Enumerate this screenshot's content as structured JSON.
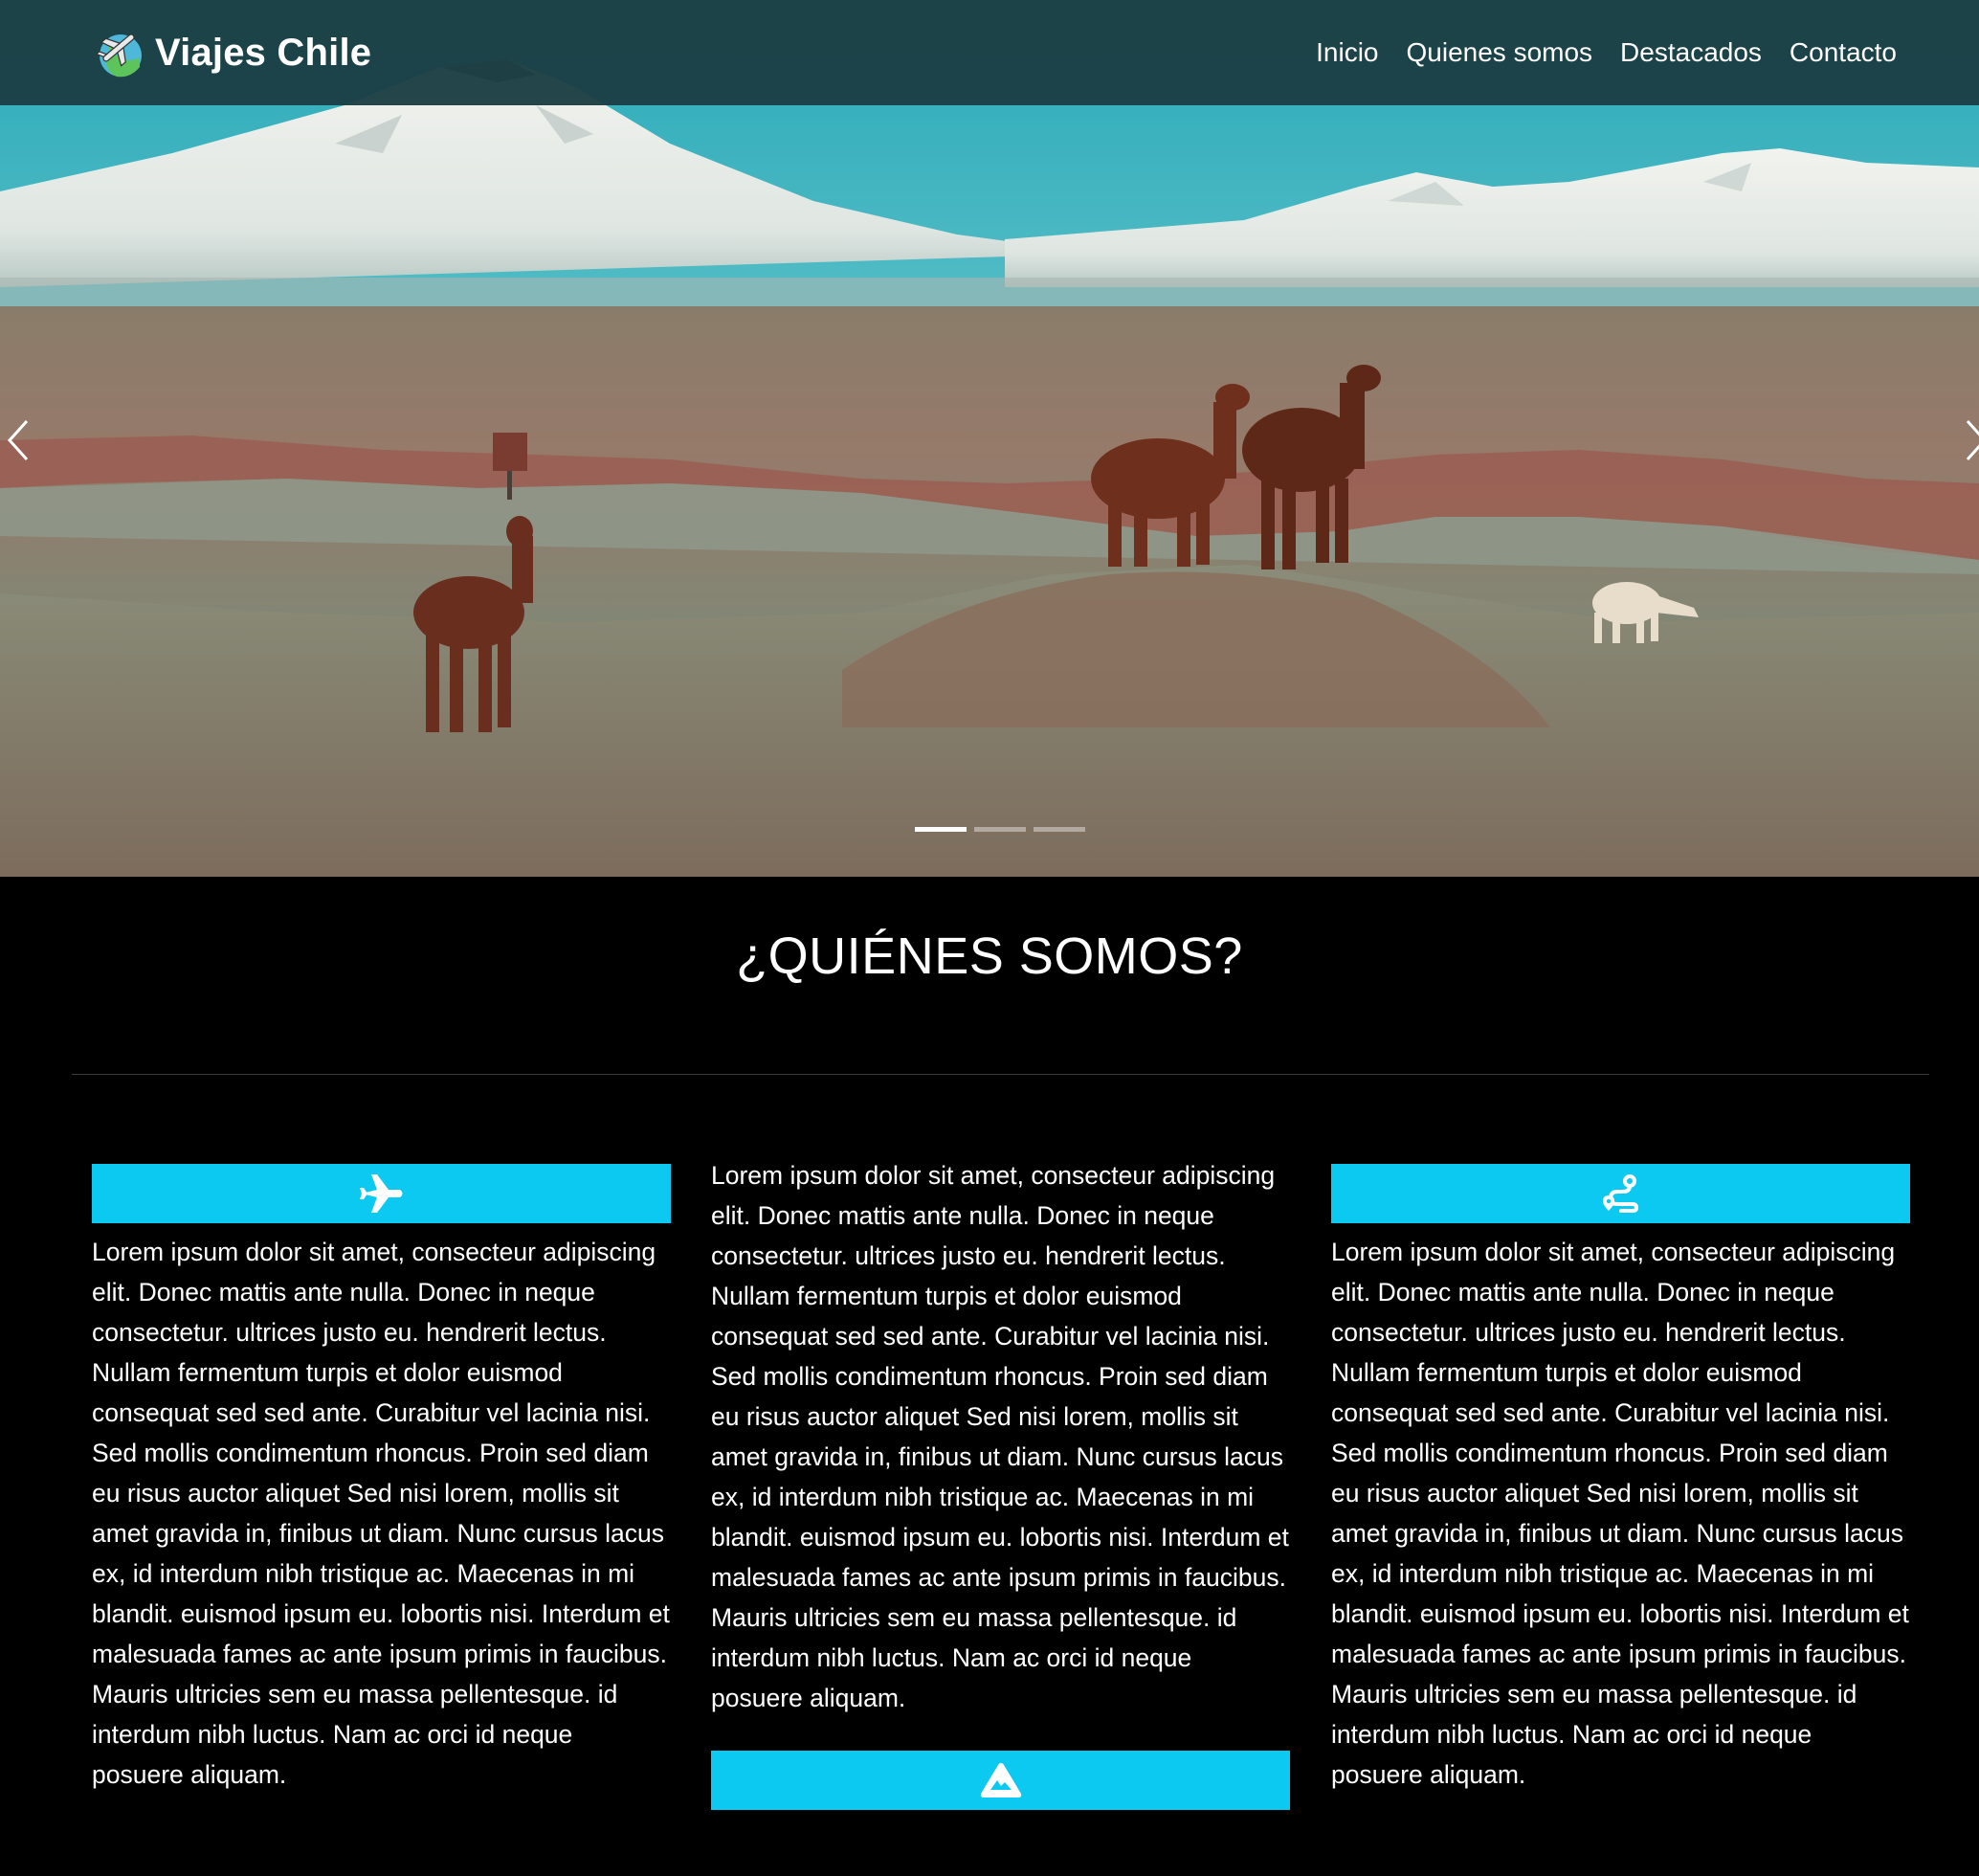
{
  "brand": {
    "name": "Viajes Chile",
    "logo_icon": "globe-airplane-icon"
  },
  "nav": {
    "items": [
      {
        "label": "Inicio"
      },
      {
        "label": "Quienes somos"
      },
      {
        "label": "Destacados"
      },
      {
        "label": "Contacto"
      }
    ]
  },
  "hero": {
    "slide_count": 3,
    "active_slide": 1,
    "prev_icon": "chevron-left-icon",
    "next_icon": "chevron-right-icon"
  },
  "about": {
    "title": "¿QUIÉNES SOMOS?",
    "columns": [
      {
        "icon": "airplane-icon",
        "text": "Lorem ipsum dolor sit amet, consecteur adipiscing elit. Donec mattis ante nulla. Donec in neque consectetur. ultrices justo eu. hendrerit lectus. Nullam fermentum turpis et dolor euismod consequat sed sed ante. Curabitur vel lacinia nisi. Sed mollis condimentum rhoncus. Proin sed diam eu risus auctor aliquet Sed nisi lorem, mollis sit amet gravida in, finibus ut diam. Nunc cursus lacus ex, id interdum nibh tristique ac. Maecenas in mi blandit. euismod ipsum eu. lobortis nisi. Interdum et malesuada fames ac ante ipsum primis in faucibus. Mauris ultricies sem eu massa pellentesque. id interdum nibh luctus. Nam ac orci id neque posuere aliquam."
      },
      {
        "icon": "mountain-icon",
        "text": "Lorem ipsum dolor sit amet, consecteur adipiscing elit. Donec mattis ante nulla. Donec in neque consectetur. ultrices justo eu. hendrerit lectus. Nullam fermentum turpis et dolor euismod consequat sed sed ante. Curabitur vel lacinia nisi. Sed mollis condimentum rhoncus. Proin sed diam eu risus auctor aliquet Sed nisi lorem, mollis sit amet gravida in, finibus ut diam. Nunc cursus lacus ex, id interdum nibh tristique ac. Maecenas in mi blandit. euismod ipsum eu. lobortis nisi. Interdum et malesuada fames ac ante ipsum primis in faucibus. Mauris ultricies sem eu massa pellentesque. id interdum nibh luctus. Nam ac orci id neque posuere aliquam."
      },
      {
        "icon": "route-icon",
        "text": "Lorem ipsum dolor sit amet, consecteur adipiscing elit. Donec mattis ante nulla. Donec in neque consectetur. ultrices justo eu. hendrerit lectus. Nullam fermentum turpis et dolor euismod consequat sed sed ante. Curabitur vel lacinia nisi. Sed mollis condimentum rhoncus. Proin sed diam eu risus auctor aliquet Sed nisi lorem, mollis sit amet gravida in, finibus ut diam. Nunc cursus lacus ex, id interdum nibh tristique ac. Maecenas in mi blandit. euismod ipsum eu. lobortis nisi. Interdum et malesuada fames ac ante ipsum primis in faucibus. Mauris ultricies sem eu massa pellentesque. id interdum nibh luctus. Nam ac orci id neque posuere aliquam."
      }
    ]
  },
  "colors": {
    "navbar_bg": "#1b3e44",
    "accent": "#0bc9f0",
    "page_bg": "#000000",
    "text": "#ffffff"
  }
}
